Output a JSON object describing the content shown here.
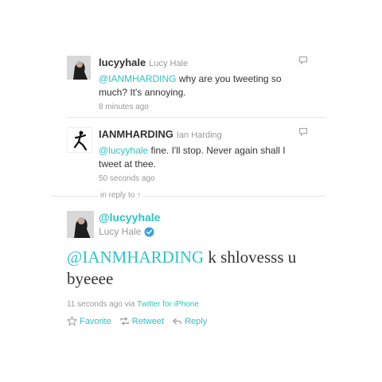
{
  "tweets": [
    {
      "username": "lucyyhale",
      "fullname": "Lucy Hale",
      "mention": "@IANMHARDING",
      "text": " why are you tweeting so much? It's annoying.",
      "time": "8 minutes ago"
    },
    {
      "username": "IANMHARDING",
      "fullname": "Ian Harding",
      "mention": "@lucyyhale",
      "text": " fine. I'll stop. Never again shall I tweet at thee.",
      "time": "50 seconds ago"
    }
  ],
  "in_reply_to": "in reply to ↑",
  "main": {
    "handle": "@lucyyhale",
    "fullname": "Lucy Hale",
    "mention": "@IANMHARDING",
    "text": " k shlovesss u byeeee",
    "time": "11 seconds ago",
    "via": "via",
    "source": "Twitter for iPhone",
    "actions": {
      "favorite": "Favorite",
      "retweet": "Retweet",
      "reply": "Reply"
    }
  },
  "colors": {
    "link": "#2fc2c2",
    "muted": "#999999"
  }
}
